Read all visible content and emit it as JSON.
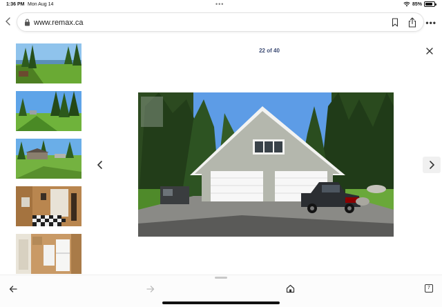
{
  "status_bar": {
    "time": "1:36 PM",
    "date": "Mon Aug 14",
    "battery_percent": "85%",
    "battery_level": 0.85
  },
  "browser": {
    "url": "www.remax.ca",
    "back_icon": "chevron-left-icon",
    "lock_icon": "lock-icon",
    "bookmark_icon": "bookmark-icon",
    "share_icon": "share-icon",
    "more_icon": "ellipsis-icon"
  },
  "gallery": {
    "counter": "22 of 40",
    "current_index": 22,
    "total": 40,
    "thumbnails": [
      {
        "scene": "lakeside lawn with trees"
      },
      {
        "scene": "grassy lawn with tall trees"
      },
      {
        "scene": "house in clearing with trees"
      },
      {
        "scene": "bathroom interior with checkered floor"
      },
      {
        "scene": "kitchen interior with appliances"
      }
    ],
    "main_photo": {
      "scene": "two-car garage with pickup truck in forest"
    },
    "close_icon": "close-icon",
    "prev_icon": "chevron-left-icon",
    "next_icon": "chevron-right-icon"
  },
  "toolbar": {
    "back_icon": "arrow-left-icon",
    "forward_icon": "arrow-right-icon",
    "home_icon": "home-icon",
    "tabs_count": "7"
  },
  "colors": {
    "counter_text": "#3b4a73",
    "sky": "#4a90e2",
    "grass": "#5e9c2e",
    "garage_siding": "#b4b7ad"
  }
}
